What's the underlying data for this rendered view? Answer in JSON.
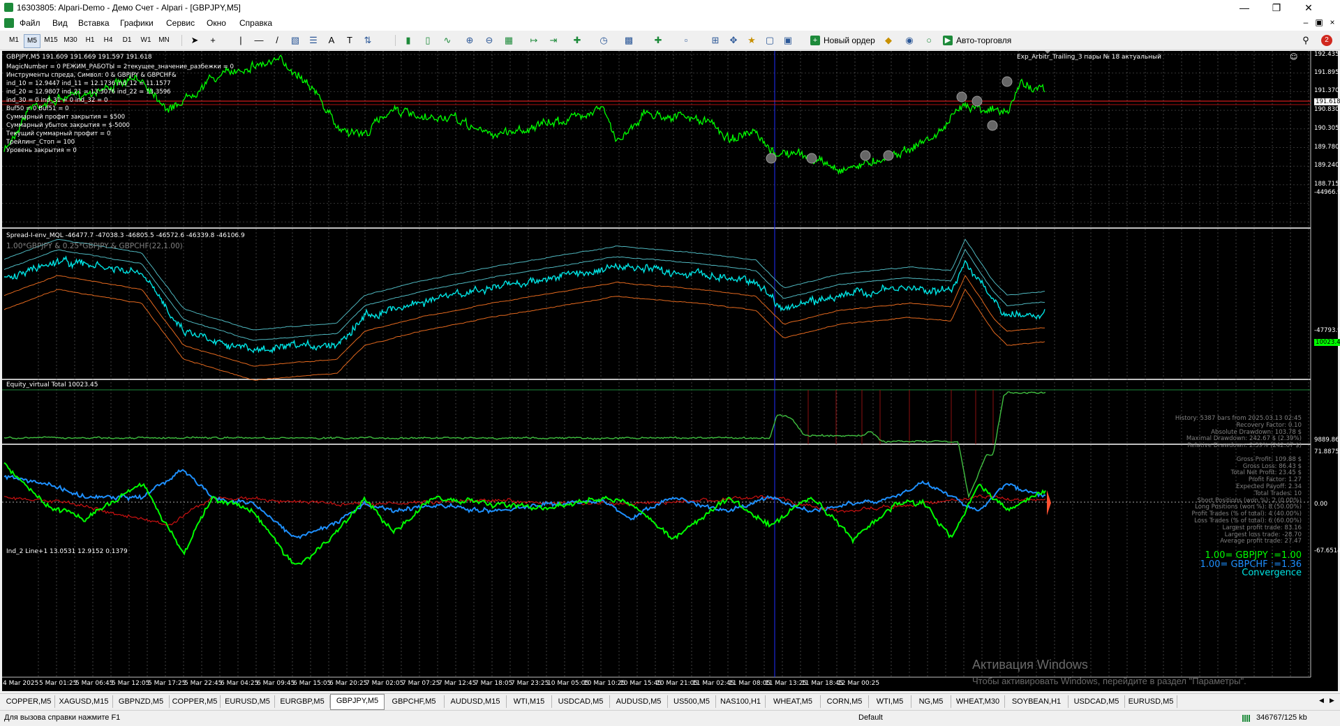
{
  "window": {
    "title": "16303805: Alpari-Demo - Демо Счет - Alpari - [GBPJPY,M5]"
  },
  "menu": {
    "items": [
      "Файл",
      "Вид",
      "Вставка",
      "Графики",
      "Сервис",
      "Окно",
      "Справка"
    ]
  },
  "toolbar": {
    "timeframes": [
      "M1",
      "M5",
      "M15",
      "M30",
      "H1",
      "H4",
      "D1",
      "W1",
      "MN"
    ],
    "active_timeframe": "M5",
    "new_order_label": "Новый ордер",
    "autotrading_label": "Авто-торговля",
    "notification_count": "2"
  },
  "main_chart": {
    "header": "GBPJPY,M5  191.609 191.669 191.597 191.618",
    "expert_label": "Exp_Arbitr_Trailing_3 пары № 18 актуальный",
    "info_lines": [
      "MagicNumber = 0 РЕЖИМ_РАБОТЫ = 2текущее_значение_разбежки = 0",
      "Инструменты спреда, Символ: 0 & GBPJPY & GBPCHF&",
      "ind_10 = 12.9447 ind_11 = 12.1736 ind_12 = 11.1577",
      "ind_20 = 12.9807 ind_21 = 13.3076 ind_22 = 13.3596",
      "ind_30 = 0 ind_31 = 0 ind_32 = 0",
      "Buf50 = 0 Buf51 = 0",
      "Суммарный профит закрытия = $500",
      "Суммарный убыток закрытия = $-5000",
      "Текущий суммарный профит = 0",
      "Трейлинг_Стоп = 100",
      "Уровень закрытия = 0"
    ],
    "current_price": "191.618",
    "price_ticks": [
      "192.435",
      "191.895",
      "191.370",
      "190.830",
      "190.305",
      "189.780",
      "189.240",
      "188.715"
    ]
  },
  "spread_panel": {
    "header": "Spread-I-env_MQL -46477.7 -47038.3 -46805.5 -46572.6 -46339.8 -46106.9",
    "sub_header": "1.00*GBPJPY & 0.25*GBPJPY & GBPCHF(22,1.00)",
    "top_value": "-44966.9",
    "bottom_value": "-47793.9"
  },
  "equity_panel": {
    "header": "Equity_virtual Total 10023.45",
    "current_value": "10023.45",
    "bottom_value": "9889.86",
    "stats": [
      "History: 5387 bars from 2025.03.13 02:45",
      "Recovery Factor: 0.10",
      "Absolute Drawdown: 103.78 $",
      "Maximal Drawdown: 242.67 $ (2.39%)",
      "Relative Drawdown: 2.39% (242.67 $)",
      "",
      "Gross Profit: 109.88 $",
      "Gross Loss: 86.43 $",
      "Total Net Profit: 23.45 $",
      "Profit Factor: 1.27",
      "Expected Payoff: 2.34",
      "Total Trades: 10",
      "Short Positions (won %): 2 (0.00%)",
      "Long Positions (won %): 8 (50.00%)",
      "Profit Trades (% of total): 4 (40.00%)",
      "Loss Trades (% of total): 6 (60.00%)",
      "Largest profit trade: 83.16",
      "Largest loss trade: -28.70",
      "Average profit trade: 27.47"
    ]
  },
  "ind_panel": {
    "header": "Ind_2 Line+1 13.0531 12.9152 0.1379",
    "top_value": "71.8875",
    "zero_value": "0.00",
    "bottom_value": "-67.6514",
    "legend": [
      {
        "text": "1.00= GBPJPY :=1.00",
        "color": "#00ff00"
      },
      {
        "text": "1.00= GBPCHF :=1.36",
        "color": "#1e90ff"
      },
      {
        "text": "Convergence",
        "color": "#00e5e5"
      }
    ]
  },
  "time_axis": [
    "4 Mar 2025",
    "5 Mar 01:25",
    "5 Mar 06:45",
    "5 Mar 12:05",
    "5 Mar 17:25",
    "5 Mar 22:45",
    "6 Mar 04:25",
    "6 Mar 09:45",
    "6 Mar 15:05",
    "6 Mar 20:25",
    "7 Mar 02:05",
    "7 Mar 07:25",
    "7 Mar 12:45",
    "7 Mar 18:05",
    "7 Mar 23:25",
    "10 Mar 05:05",
    "10 Mar 10:25",
    "10 Mar 15:45",
    "10 Mar 21:05",
    "11 Mar 02:45",
    "11 Mar 08:05",
    "11 Mar 13:25",
    "11 Mar 18:45",
    "12 Mar 00:25"
  ],
  "watermark": {
    "title": "Активация Windows",
    "subtitle": "Чтобы активировать Windows, перейдите в раздел \"Параметры\"."
  },
  "tabs": [
    "COPPER,M5",
    "XAGUSD,M15",
    "GBPNZD,M5",
    "COPPER,M5",
    "EURUSD,M5",
    "EURGBP,M5",
    "GBPJPY,M5",
    "GBPCHF,M5",
    "AUDUSD,M15",
    "WTI,M15",
    "USDCAD,M5",
    "AUDUSD,M5",
    "US500,M5",
    "NAS100,H1",
    "WHEAT,M5",
    "CORN,M5",
    "WTI,M5",
    "NG,M5",
    "WHEAT,M30",
    "SOYBEAN,H1",
    "USDCAD,M5",
    "EURUSD,M5"
  ],
  "active_tab": "GBPJPY,M5",
  "status": {
    "help": "Для вызова справки нажмите F1",
    "profile": "Default",
    "traffic": "346767/125 kb"
  },
  "colors": {
    "price": "#00ff00",
    "spread_cyan": "#00e5e5",
    "envelope_orange": "#e5691e",
    "equity": "#40c040",
    "ind_blue": "#1e90ff",
    "ind_red": "#cc1111",
    "level_red": "#ff2020"
  }
}
